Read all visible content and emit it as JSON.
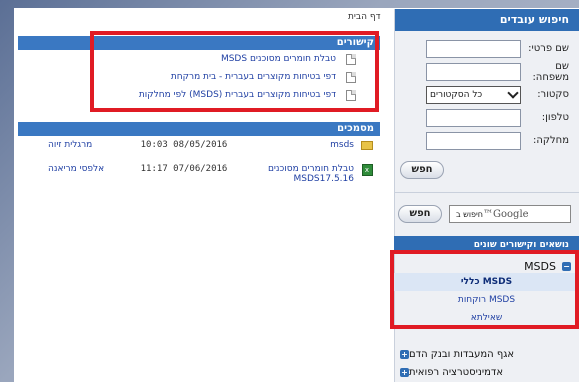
{
  "breadcrumb": "דף הבית",
  "links_panel": {
    "title": "קישורים",
    "items": [
      "טבלת חומרים מסוכנים MSDS",
      "דפי בטיחות מקוצרים בעברית - בית מרקחת",
      "דפי בטיחות מקוצרים בעברית (MSDS) לפי מחלקות"
    ]
  },
  "docs_panel": {
    "title": "מסמכים",
    "rows": [
      {
        "icon": "folder-icon",
        "name": "msds",
        "date": "10:03 08/05/2016",
        "user": "מרגלית זיוה"
      },
      {
        "icon": "excel-icon",
        "name": "טבלת חומרים מסוכנים MSDS17.5.16",
        "date": "11:17 07/06/2016",
        "user": "אלפסי מריאנה"
      }
    ]
  },
  "employee_search": {
    "title": "חיפוש עובדים",
    "fields": [
      {
        "label": "שם פרטי:",
        "value": ""
      },
      {
        "label": "שם משפחה:",
        "value": ""
      },
      {
        "label": "סקטור:",
        "value": "כל הסקטורים"
      },
      {
        "label": "טלפון:",
        "value": ""
      },
      {
        "label": "מחלקה:",
        "value": ""
      }
    ],
    "button": "חפש"
  },
  "google_search": {
    "label": "חיפוש ב",
    "logo": "Google™",
    "button": "חפש"
  },
  "topics": {
    "title": "נושאים וקישורים שונים",
    "main": "MSDS",
    "main_symbol": "−",
    "subitems": [
      "MSDS כללי",
      "MSDS רוקחות",
      "שאילתא"
    ],
    "categories": [
      {
        "label": "אגף המעבדות ובנק הדם",
        "symbol": "+"
      },
      {
        "label": "אדמיניסטרציה רפואית",
        "symbol": "+"
      }
    ]
  },
  "colors": {
    "header_blue": "#2f6db4",
    "highlight_red": "#e01b24",
    "link_blue": "#1f3fa3"
  }
}
